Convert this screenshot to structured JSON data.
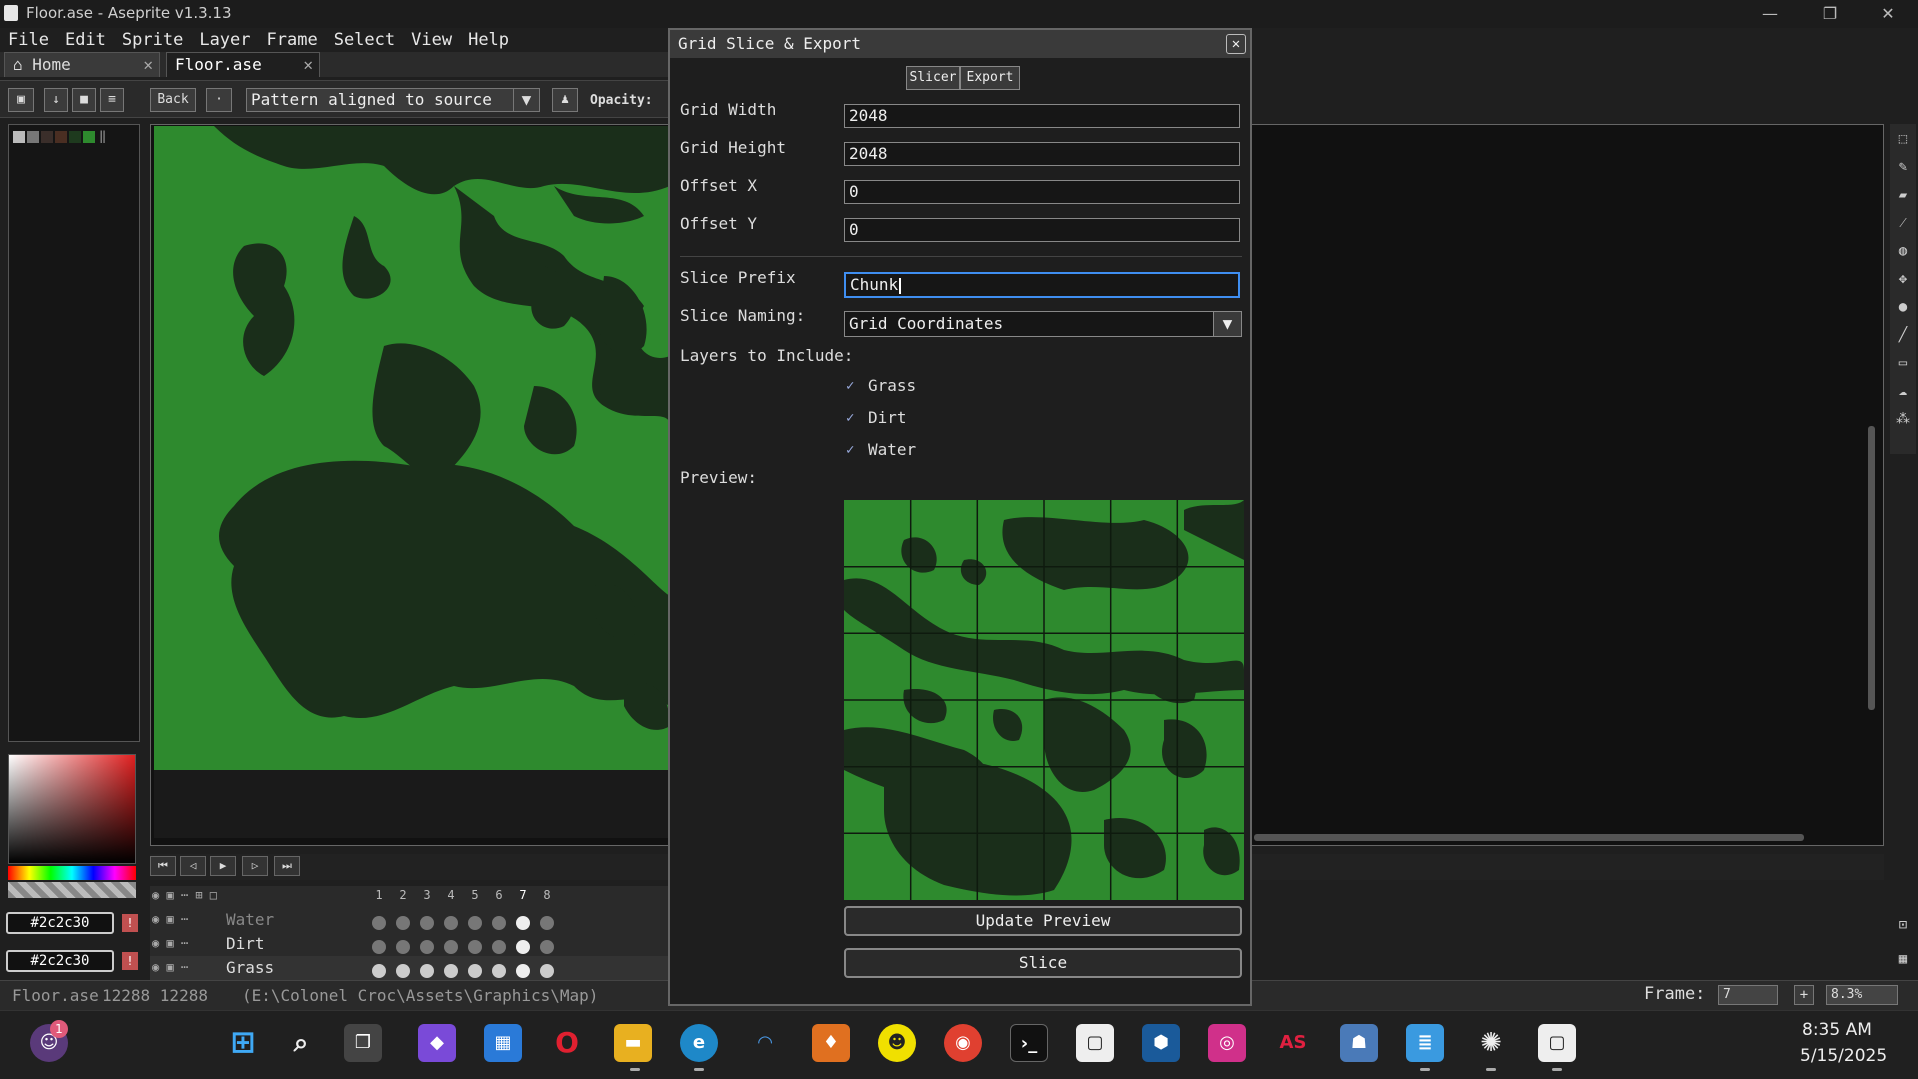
{
  "window": {
    "title": "Floor.ase - Aseprite v1.3.13",
    "minimize": "—",
    "maximize": "❐",
    "close": "✕"
  },
  "menu": [
    "File",
    "Edit",
    "Sprite",
    "Layer",
    "Frame",
    "Select",
    "View",
    "Help"
  ],
  "tabs": [
    {
      "label": "Home",
      "icon": "home-icon"
    },
    {
      "label": "Floor.ase",
      "active": true
    }
  ],
  "context_bar": {
    "back_label": "Back",
    "pattern_value": "Pattern aligned to source",
    "opacity_label": "Opacity:"
  },
  "colors": {
    "fg_hex": "#2c2c30",
    "bg_hex": "#2c2c30",
    "grass": "#2e8a2e",
    "dirt_dark": "#1a2e1a",
    "accent": "#3f8ef0"
  },
  "layers": [
    {
      "name": "Water",
      "dim": true
    },
    {
      "name": "Dirt"
    },
    {
      "name": "Grass"
    }
  ],
  "frames": [
    "1",
    "2",
    "3",
    "4",
    "5",
    "6",
    "7",
    "8"
  ],
  "status": {
    "file": "Floor.ase",
    "size": "12288 12288",
    "path": "(E:\\Colonel Croc\\Assets\\Graphics\\Map)",
    "frame_label": "Frame:",
    "frame_value": "7",
    "zoom": "8.3%"
  },
  "dialog": {
    "title": "Grid Slice & Export",
    "tabs": [
      "Slicer",
      "Export"
    ],
    "grid_width_label": "Grid Width",
    "grid_width": "2048",
    "grid_height_label": "Grid Height",
    "grid_height": "2048",
    "offset_x_label": "Offset X",
    "offset_x": "0",
    "offset_y_label": "Offset Y",
    "offset_y": "0",
    "slice_prefix_label": "Slice Prefix",
    "slice_prefix": "Chunk",
    "slice_naming_label": "Slice Naming:",
    "slice_naming": "Grid Coordinates",
    "layers_label": "Layers to Include:",
    "layer_checks": [
      {
        "label": "Grass",
        "checked": true
      },
      {
        "label": "Dirt",
        "checked": true
      },
      {
        "label": "Water",
        "checked": true
      }
    ],
    "preview_label": "Preview:",
    "update_button": "Update Preview",
    "slice_button": "Slice"
  },
  "taskbar": {
    "time": "8:35 AM",
    "date": "5/15/2025",
    "notification_badge": "1"
  }
}
